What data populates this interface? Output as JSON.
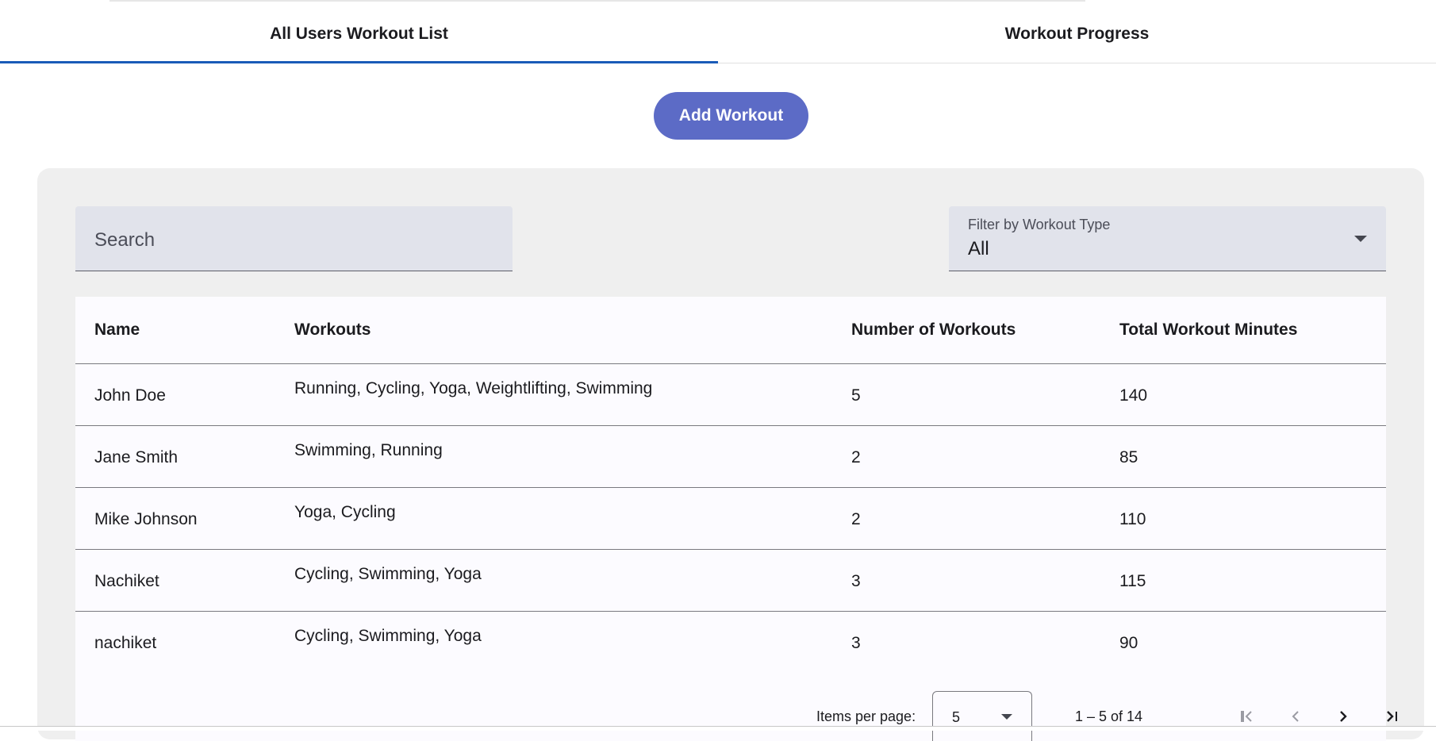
{
  "tabs": [
    {
      "label": "All Users Workout List",
      "active": true
    },
    {
      "label": "Workout Progress",
      "active": false
    }
  ],
  "add_button": {
    "label": "Add Workout"
  },
  "search": {
    "placeholder": "Search"
  },
  "filter": {
    "label": "Filter by Workout Type",
    "value": "All"
  },
  "table": {
    "headers": [
      "Name",
      "Workouts",
      "Number of Workouts",
      "Total Workout Minutes"
    ],
    "rows": [
      {
        "name": "John Doe",
        "workouts": "Running, Cycling, Yoga, Weightlifting, Swimming",
        "count": "5",
        "minutes": "140"
      },
      {
        "name": "Jane Smith",
        "workouts": "Swimming, Running",
        "count": "2",
        "minutes": "85"
      },
      {
        "name": "Mike Johnson",
        "workouts": "Yoga, Cycling",
        "count": "2",
        "minutes": "110"
      },
      {
        "name": "Nachiket",
        "workouts": "Cycling, Swimming, Yoga",
        "count": "3",
        "minutes": "115"
      },
      {
        "name": "nachiket",
        "workouts": "Cycling, Swimming, Yoga",
        "count": "3",
        "minutes": "90"
      }
    ]
  },
  "paginator": {
    "items_per_page_label": "Items per page:",
    "items_per_page_value": "5",
    "range_label": "1 – 5 of 14"
  },
  "colors": {
    "accent": "#1a5bb8",
    "button": "#5c6bc6",
    "card_bg": "#efefef",
    "field_bg": "#e1e3eb"
  },
  "icons": [
    "first-page-icon",
    "chevron-left-icon",
    "chevron-right-icon",
    "last-page-icon",
    "arrow-drop-down-icon"
  ]
}
